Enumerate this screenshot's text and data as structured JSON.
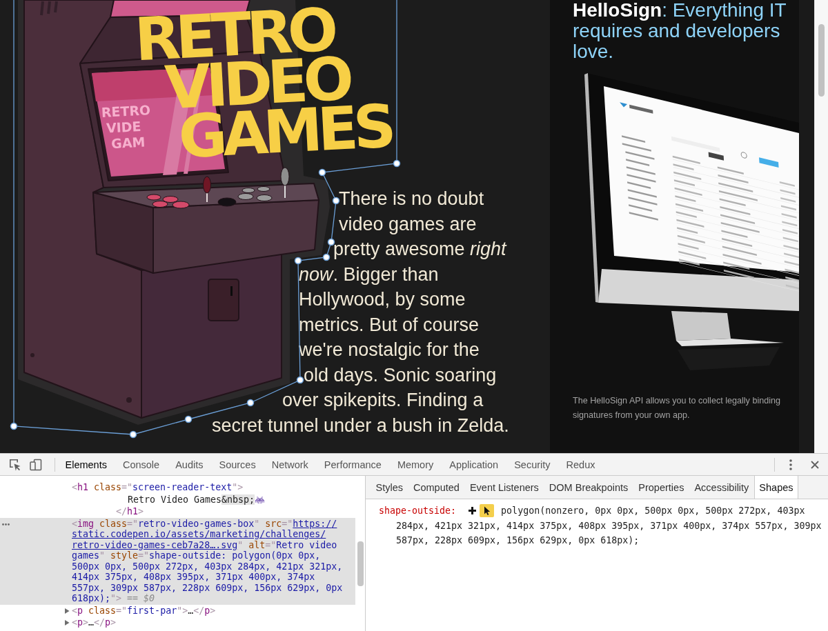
{
  "page": {
    "illustration": {
      "title_lines": [
        "RETRO",
        "VIDEO",
        "GAMES"
      ],
      "screen_lines": [
        "RETRO",
        "VIDE",
        "GAM"
      ]
    },
    "article": {
      "lines": [
        "There is no doubt",
        "video games are",
        "pretty awesome *right*",
        "*now*. Bigger than",
        "Hollywood, by some",
        "metrics. But of course",
        "we're nostalgic for the",
        "old days. Sonic soaring",
        "over spikepits. Finding a",
        "secret tunnel under a bush in Zelda."
      ]
    },
    "ad": {
      "heading": "**HelloSign**: Everything IT requires and developers love.",
      "caption": "The HelloSign API allows you to collect legally binding signatures from your own app."
    }
  },
  "devtools": {
    "tabs": [
      {
        "label": "Elements",
        "selected": true
      },
      {
        "label": "Console",
        "selected": false
      },
      {
        "label": "Audits",
        "selected": false
      },
      {
        "label": "Sources",
        "selected": false
      },
      {
        "label": "Network",
        "selected": false
      },
      {
        "label": "Performance",
        "selected": false
      },
      {
        "label": "Memory",
        "selected": false
      },
      {
        "label": "Application",
        "selected": false
      },
      {
        "label": "Security",
        "selected": false
      },
      {
        "label": "Redux",
        "selected": false
      }
    ],
    "elements": {
      "tree": [
        {
          "kind": "element",
          "selected": false,
          "segments": [
            {
              "kind": "punct",
              "text": "<"
            },
            {
              "kind": "tag",
              "text": "h1"
            },
            {
              "kind": "attr",
              "text": " class"
            },
            {
              "kind": "punct",
              "text": "=\""
            },
            {
              "kind": "value",
              "text": "screen-reader-text"
            },
            {
              "kind": "punct",
              "text": "\">"
            }
          ],
          "children": [
            {
              "kind": "text",
              "selected": false,
              "segments": [
                {
                  "kind": "text",
                  "text": "Retro Video Games"
                },
                {
                  "kind": "entity",
                  "text": "&nbsp;"
                },
                {
                  "kind": "icon"
                }
              ]
            }
          ],
          "closing": [
            {
              "kind": "punct",
              "text": "</"
            },
            {
              "kind": "tag",
              "text": "h1"
            },
            {
              "kind": "punct",
              "text": ">"
            }
          ]
        },
        {
          "kind": "element",
          "selected": true,
          "segments": [
            {
              "kind": "punct",
              "text": "<"
            },
            {
              "kind": "tag",
              "text": "img"
            },
            {
              "kind": "attr",
              "text": " class"
            },
            {
              "kind": "punct",
              "text": "=\""
            },
            {
              "kind": "value",
              "text": "retro-video-games-box"
            },
            {
              "kind": "punct",
              "text": "\""
            },
            {
              "kind": "attr",
              "text": " src"
            },
            {
              "kind": "punct",
              "text": "=\""
            },
            {
              "kind": "link",
              "text": "https://static.codepen.io/assets/marketing/challenges/retro-video-games-ceb7a28….svg"
            },
            {
              "kind": "punct",
              "text": "\""
            },
            {
              "kind": "attr",
              "text": " alt"
            },
            {
              "kind": "punct",
              "text": "=\""
            },
            {
              "kind": "value",
              "text": "Retro video games"
            },
            {
              "kind": "punct",
              "text": "\""
            },
            {
              "kind": "attr",
              "text": " style"
            },
            {
              "kind": "punct",
              "text": "=\""
            },
            {
              "kind": "value",
              "text": "shape-outside: polygon(0px 0px, 500px 0px, 500px 272px, 403px 284px, 421px 321px, 414px 375px, 408px 395px, 371px 400px, 374px 557px, 309px 587px, 228px 609px, 156px 629px, 0px 618px);"
            },
            {
              "kind": "punct",
              "text": "\">"
            },
            {
              "kind": "ref",
              "text": " == $0"
            }
          ]
        },
        {
          "kind": "element",
          "selected": false,
          "expanded": false,
          "segments": [
            {
              "kind": "punct",
              "text": "<"
            },
            {
              "kind": "tag",
              "text": "p"
            },
            {
              "kind": "attr",
              "text": " class"
            },
            {
              "kind": "punct",
              "text": "=\""
            },
            {
              "kind": "value",
              "text": "first-par"
            },
            {
              "kind": "punct",
              "text": "\">"
            },
            {
              "kind": "text",
              "text": "…"
            },
            {
              "kind": "punct",
              "text": "</"
            },
            {
              "kind": "tag",
              "text": "p"
            },
            {
              "kind": "punct",
              "text": ">"
            }
          ]
        },
        {
          "kind": "element",
          "selected": false,
          "expanded": false,
          "segments": [
            {
              "kind": "punct",
              "text": "<"
            },
            {
              "kind": "tag",
              "text": "p"
            },
            {
              "kind": "punct",
              "text": ">"
            },
            {
              "kind": "text",
              "text": "…"
            },
            {
              "kind": "punct",
              "text": "</"
            },
            {
              "kind": "tag",
              "text": "p"
            },
            {
              "kind": "punct",
              "text": ">"
            }
          ]
        }
      ]
    },
    "sidebar_tabs": [
      {
        "label": "Styles",
        "selected": false
      },
      {
        "label": "Computed",
        "selected": false
      },
      {
        "label": "Event Listeners",
        "selected": false
      },
      {
        "label": "DOM Breakpoints",
        "selected": false
      },
      {
        "label": "Properties",
        "selected": false
      },
      {
        "label": "Accessibility",
        "selected": false
      },
      {
        "label": "Shapes",
        "selected": true
      }
    ],
    "shapes_pane": {
      "property": "shape-outside:",
      "value": "polygon(nonzero, 0px 0px, 500px 0px, 500px 272px, 403px 284px, 421px 321px, 414px 375px, 408px 395px, 371px 400px, 374px 557px, 309px 587px, 228px 609px, 156px 629px, 0px 618px);"
    }
  }
}
